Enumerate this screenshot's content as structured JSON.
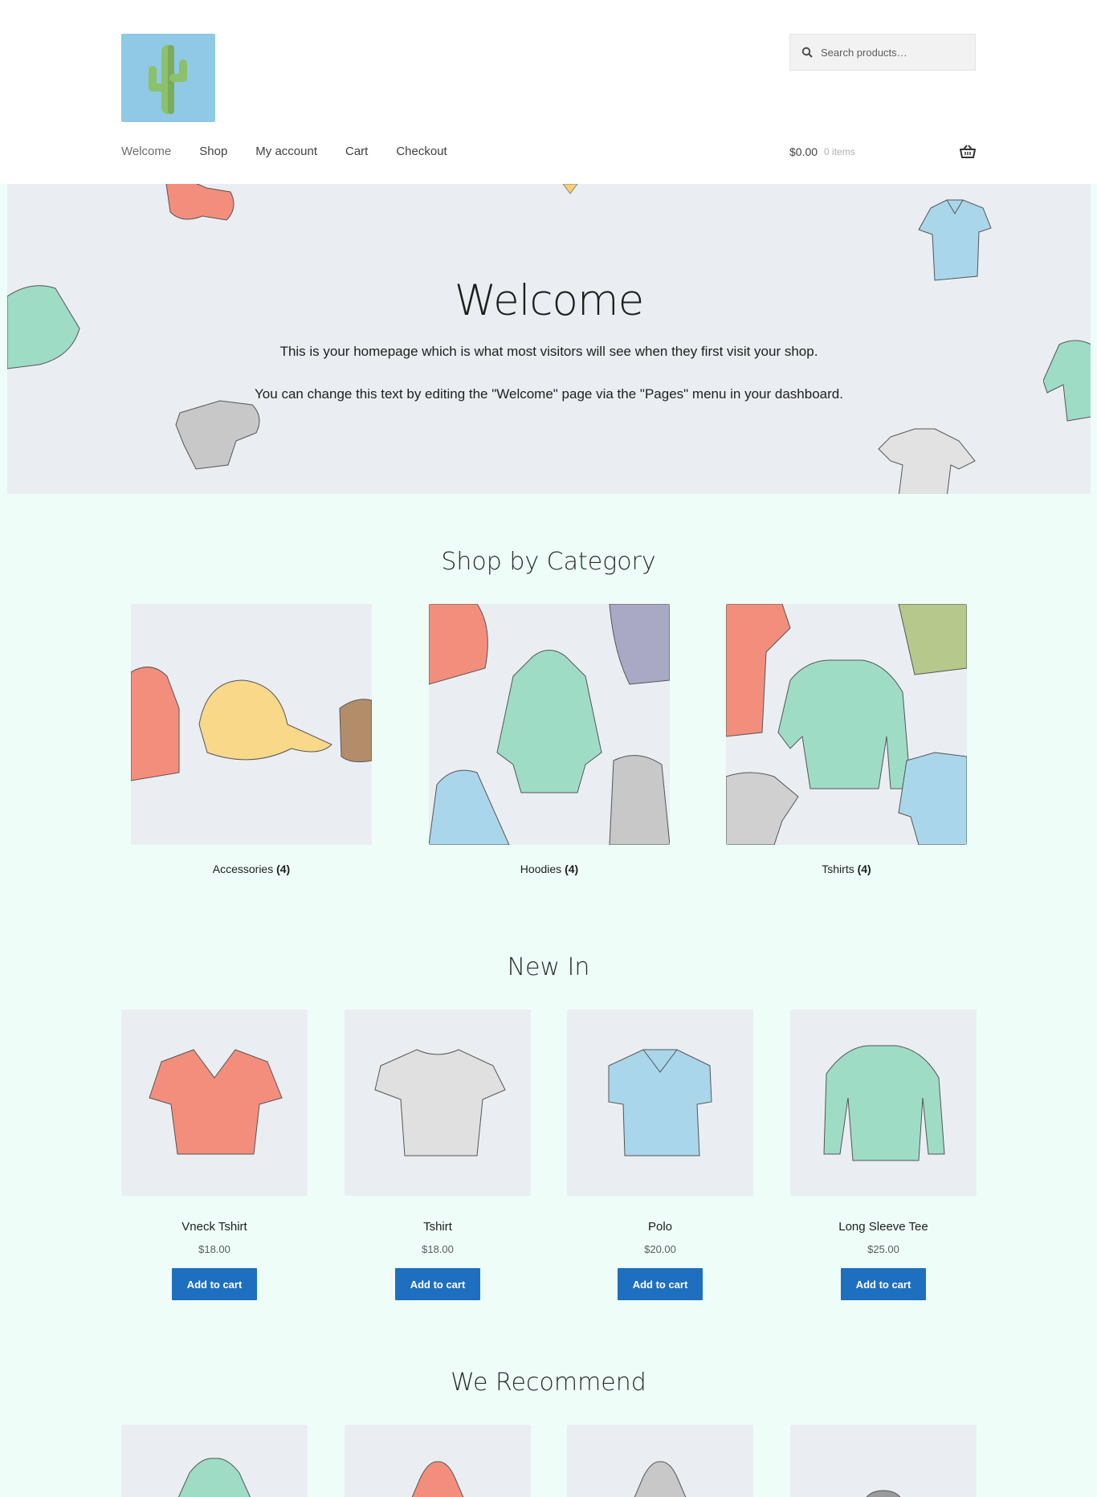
{
  "header": {
    "logo_icon": "cactus-icon",
    "search": {
      "placeholder": "Search products…"
    },
    "nav": [
      "Welcome",
      "Shop",
      "My account",
      "Cart",
      "Checkout"
    ],
    "cart": {
      "amount": "$0.00",
      "count": "0 items"
    }
  },
  "hero": {
    "title": "Welcome",
    "text1": "This is your homepage which is what most visitors will see when they first visit your shop.",
    "text2": "You can change this text by editing the \"Welcome\" page via the \"Pages\" menu in your dashboard."
  },
  "categories": {
    "title": "Shop by Category",
    "items": [
      {
        "label": "Accessories",
        "count": "(4)"
      },
      {
        "label": "Hoodies",
        "count": "(4)"
      },
      {
        "label": "Tshirts",
        "count": "(4)"
      }
    ]
  },
  "new_in": {
    "title": "New In",
    "products": [
      {
        "name": "Vneck Tshirt",
        "price": "$18.00",
        "button": "Add to cart"
      },
      {
        "name": "Tshirt",
        "price": "$18.00",
        "button": "Add to cart"
      },
      {
        "name": "Polo",
        "price": "$20.00",
        "button": "Add to cart"
      },
      {
        "name": "Long Sleeve Tee",
        "price": "$25.00",
        "button": "Add to cart"
      }
    ]
  },
  "recommend": {
    "title": "We Recommend"
  },
  "colors": {
    "accent": "#1e6fbf",
    "page_bg": "#eefdf8",
    "hero_bg": "#eaeef2",
    "logo_bg": "#8fc9e6"
  }
}
